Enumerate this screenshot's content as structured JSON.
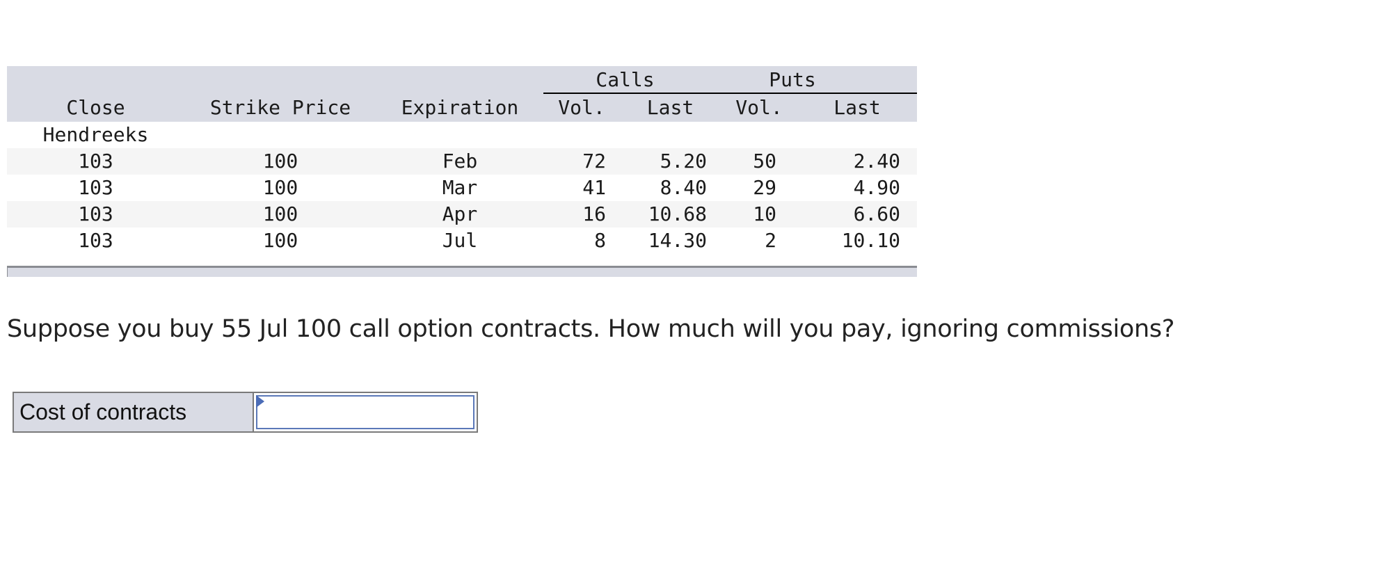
{
  "table": {
    "group_headers": {
      "calls": "Calls",
      "puts": "Puts"
    },
    "columns": {
      "close": "Close",
      "strike": "Strike Price",
      "expiration": "Expiration",
      "calls_vol": "Vol.",
      "calls_last": "Last",
      "puts_vol": "Vol.",
      "puts_last": "Last"
    },
    "company": "Hendreeks",
    "rows": [
      {
        "close": "103",
        "strike": "100",
        "expiration": "Feb",
        "calls_vol": "72",
        "calls_last": "5.20",
        "puts_vol": "50",
        "puts_last": "2.40"
      },
      {
        "close": "103",
        "strike": "100",
        "expiration": "Mar",
        "calls_vol": "41",
        "calls_last": "8.40",
        "puts_vol": "29",
        "puts_last": "4.90"
      },
      {
        "close": "103",
        "strike": "100",
        "expiration": "Apr",
        "calls_vol": "16",
        "calls_last": "10.68",
        "puts_vol": "10",
        "puts_last": "6.60"
      },
      {
        "close": "103",
        "strike": "100",
        "expiration": "Jul",
        "calls_vol": "8",
        "calls_last": "14.30",
        "puts_vol": "2",
        "puts_last": "10.10"
      }
    ]
  },
  "question": "Suppose you buy 55 Jul 100 call option contracts. How much will you pay, ignoring commissions?",
  "answer": {
    "label": "Cost of contracts",
    "value": "",
    "placeholder": ""
  }
}
